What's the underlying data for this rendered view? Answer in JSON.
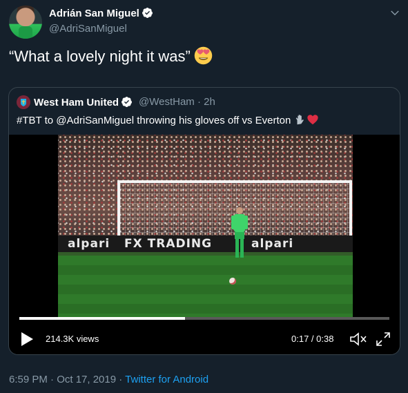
{
  "author": {
    "name": "Adrián San Miguel",
    "handle": "@AdriSanMiguel",
    "verified": true
  },
  "tweet": {
    "text": "“What a lovely night it was”",
    "emoji": "heart-eyes-emoji"
  },
  "quoted": {
    "name": "West Ham United",
    "handle": "@WestHam · 2h",
    "text": "#TBT to @AdriSanMiguel throwing his gloves off vs Everton",
    "emojis": [
      "glove-emoji",
      "red-heart-emoji"
    ]
  },
  "video": {
    "board_left": "alpari",
    "board_mid": "FX TRADING",
    "board_right": "alpari",
    "views": "214.3K views",
    "time": "0:17 / 0:38",
    "progress": 0.447
  },
  "footer": {
    "timestamp": "6:59 PM · Oct 17, 2019 · ",
    "source": "Twitter for Android"
  },
  "colors": {
    "background": "#15202b",
    "secondary_text": "#8899a6",
    "link": "#1da1f2",
    "verified": "#ffffff",
    "border": "#38444d"
  }
}
